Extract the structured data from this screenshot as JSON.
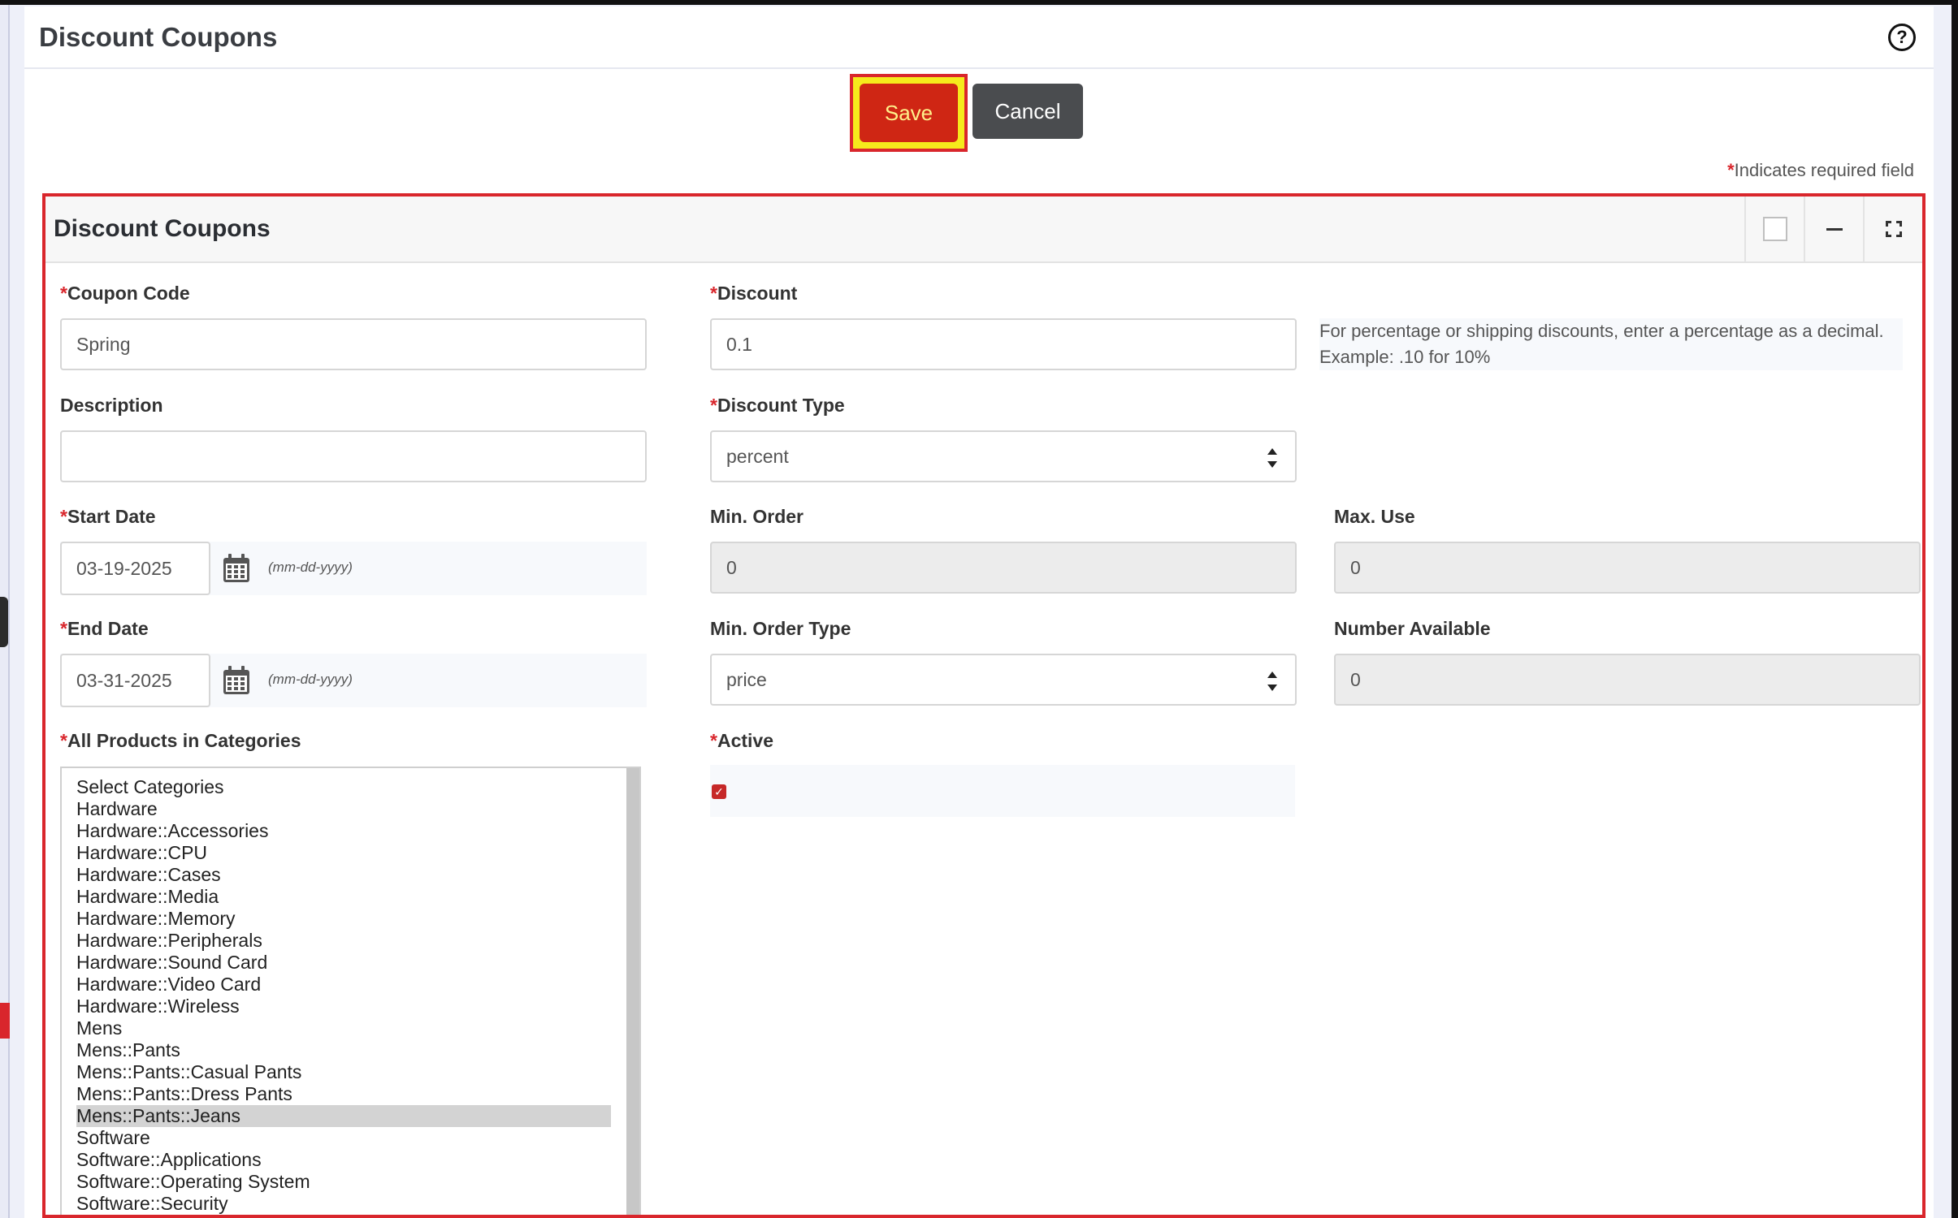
{
  "page": {
    "title": "Discount Coupons",
    "help_icon": "question-circle-icon"
  },
  "toolbar": {
    "save_label": "Save",
    "cancel_label": "Cancel",
    "required_note": "Indicates required field",
    "required_mark": "*"
  },
  "panel": {
    "title": "Discount Coupons",
    "tools": [
      "checkbox-icon",
      "minus-icon",
      "expand-icon"
    ]
  },
  "form": {
    "coupon_code": {
      "label": "Coupon Code",
      "value": "Spring"
    },
    "discount": {
      "label": "Discount",
      "value": "0.1"
    },
    "discount_help": "For percentage or shipping discounts, enter a percentage as a decimal. Example: .10 for 10%",
    "description": {
      "label": "Description",
      "value": ""
    },
    "discount_type": {
      "label": "Discount Type",
      "value": "percent"
    },
    "start_date": {
      "label": "Start Date",
      "value": "03-19-2025",
      "hint": "(mm-dd-yyyy)"
    },
    "min_order": {
      "label": "Min. Order",
      "value": "0"
    },
    "max_use": {
      "label": "Max. Use",
      "value": "0"
    },
    "end_date": {
      "label": "End Date",
      "value": "03-31-2025",
      "hint": "(mm-dd-yyyy)"
    },
    "min_order_type": {
      "label": "Min. Order Type",
      "value": "price"
    },
    "number_available": {
      "label": "Number Available",
      "value": "0"
    },
    "categories": {
      "label": "All Products in Categories",
      "options": [
        "Select Categories",
        "Hardware",
        "Hardware::Accessories",
        "Hardware::CPU",
        "Hardware::Cases",
        "Hardware::Media",
        "Hardware::Memory",
        "Hardware::Peripherals",
        "Hardware::Sound Card",
        "Hardware::Video Card",
        "Hardware::Wireless",
        "Mens",
        "Mens::Pants",
        "Mens::Pants::Casual Pants",
        "Mens::Pants::Dress Pants",
        "Mens::Pants::Jeans",
        "Software",
        "Software::Applications",
        "Software::Operating System",
        "Software::Security"
      ],
      "selected": "Mens::Pants::Jeans"
    },
    "active": {
      "label": "Active",
      "checked": true
    }
  },
  "colors": {
    "required": "#d9262c",
    "save_button": "#cf2614",
    "highlight": "#f6ea1c",
    "cancel_button": "#4a4c4f"
  }
}
